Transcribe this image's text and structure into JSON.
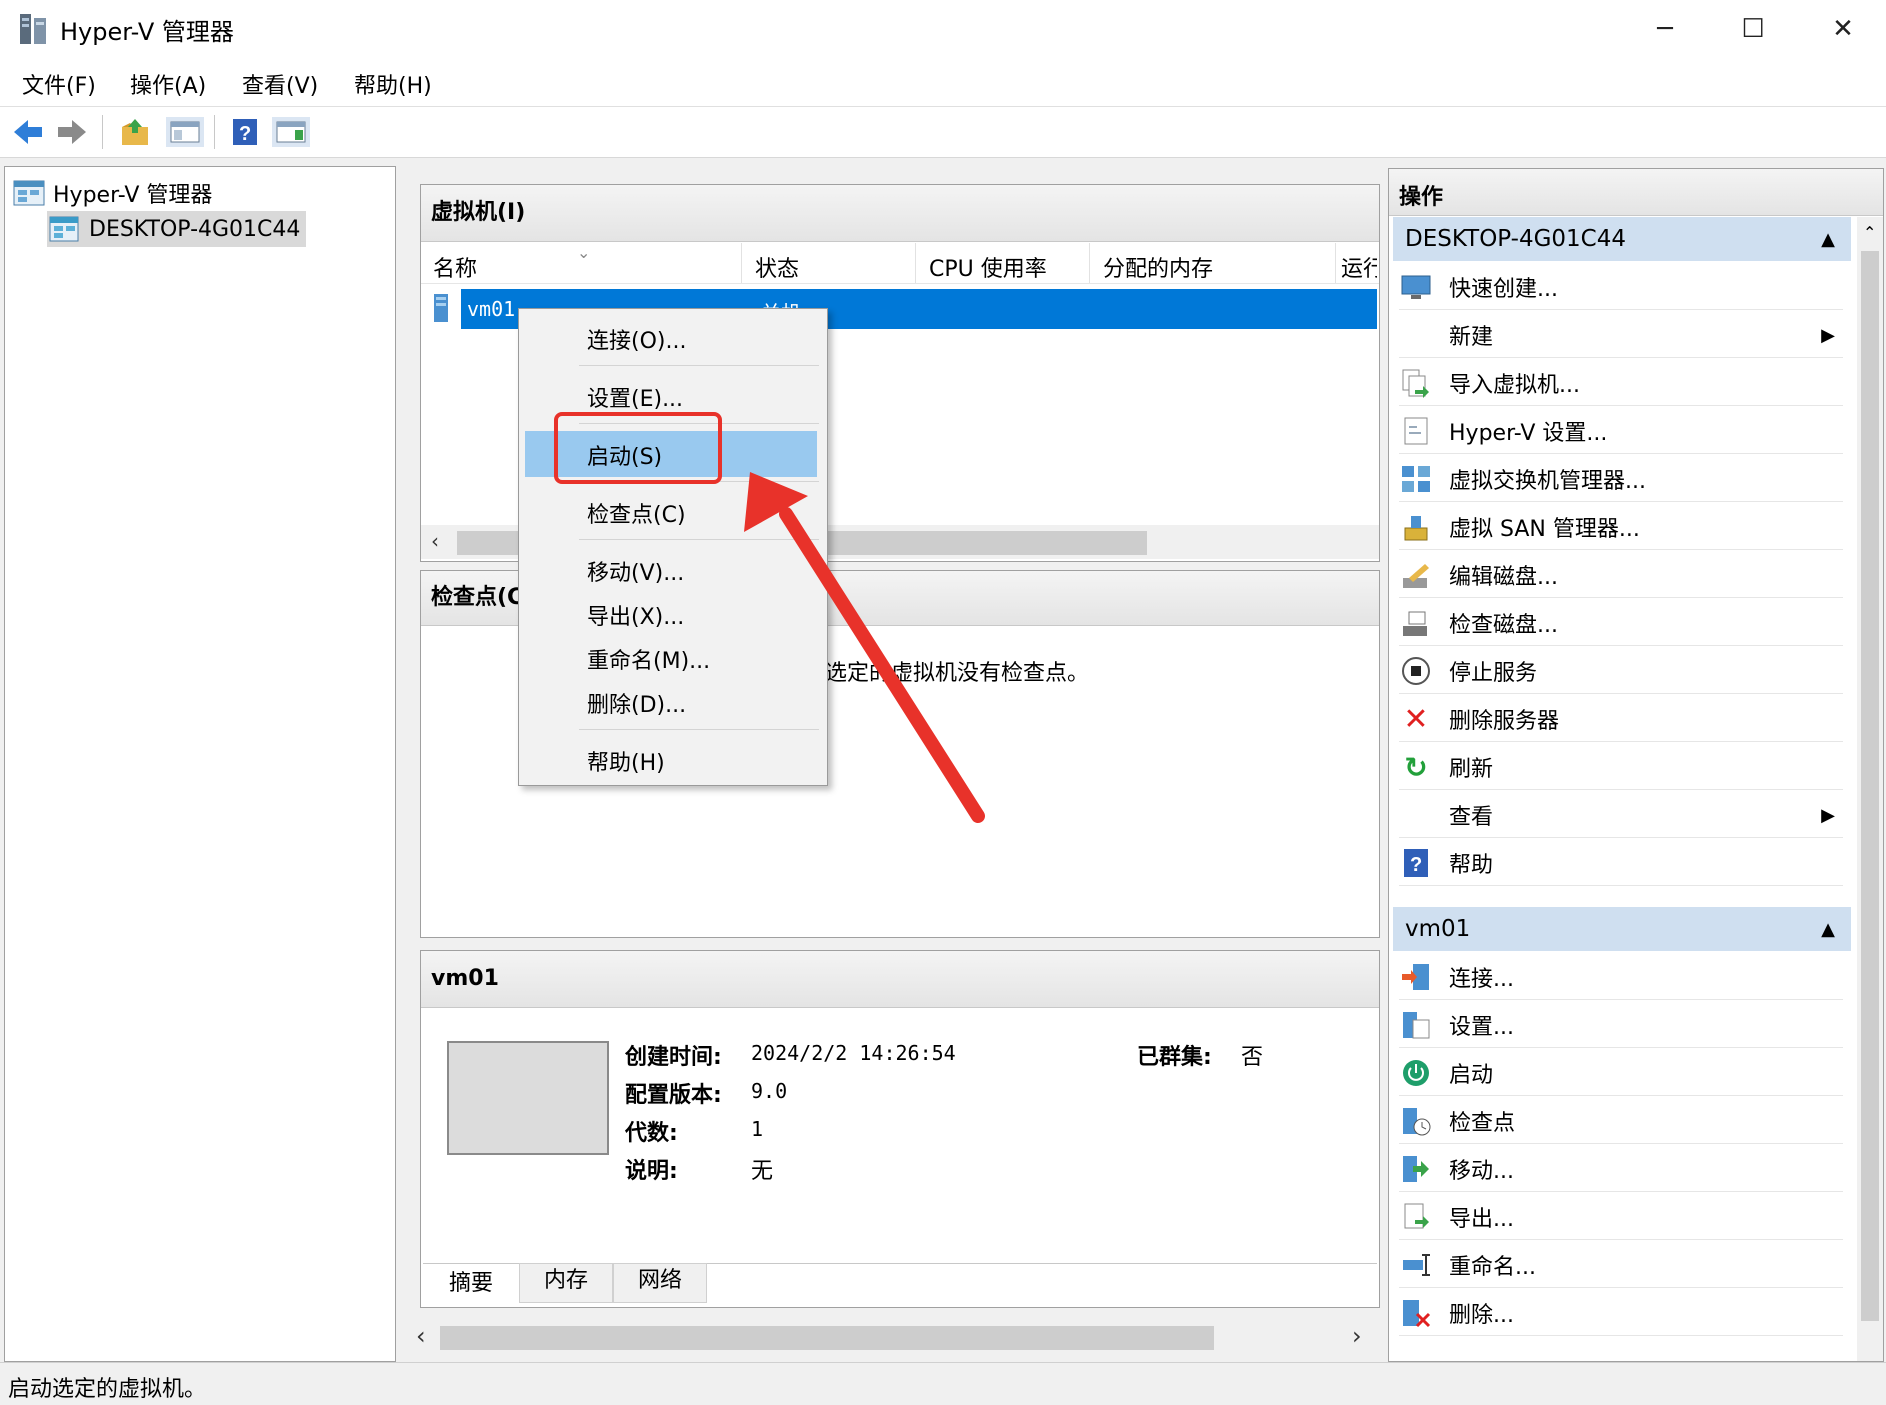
{
  "window": {
    "title": "Hyper-V 管理器"
  },
  "menu": [
    "文件(F)",
    "操作(A)",
    "查看(V)",
    "帮助(H)"
  ],
  "tree": {
    "root": "Hyper-V 管理器",
    "host": "DESKTOP-4G01C44"
  },
  "vms": {
    "title": "虚拟机(I)",
    "columns": [
      "名称",
      "状态",
      "CPU 使用率",
      "分配的内存",
      "运行"
    ],
    "rows": [
      {
        "name": "vm01",
        "state": "关机"
      }
    ]
  },
  "checkpoints": {
    "title": "检查点(C)",
    "empty": "选定的虚拟机没有检查点。"
  },
  "details": {
    "title": "vm01",
    "created_label": "创建时间:",
    "created_value": "2024/2/2 14:26:54",
    "version_label": "配置版本:",
    "version_value": "9.0",
    "generation_label": "代数:",
    "generation_value": "1",
    "notes_label": "说明:",
    "notes_value": "无",
    "cluster_label": "已群集:",
    "cluster_value": "否",
    "tabs": [
      "摘要",
      "内存",
      "网络"
    ]
  },
  "context_menu": [
    "连接(O)...",
    "设置(E)...",
    "启动(S)",
    "检查点(C)",
    "移动(V)...",
    "导出(X)...",
    "重命名(M)...",
    "删除(D)...",
    "帮助(H)"
  ],
  "actions": {
    "title": "操作",
    "host_section": "DESKTOP-4G01C44",
    "host_items": [
      "快速创建...",
      "新建",
      "导入虚拟机...",
      "Hyper-V 设置...",
      "虚拟交换机管理器...",
      "虚拟 SAN 管理器...",
      "编辑磁盘...",
      "检查磁盘...",
      "停止服务",
      "删除服务器",
      "刷新",
      "查看",
      "帮助"
    ],
    "vm_section": "vm01",
    "vm_items": [
      "连接...",
      "设置...",
      "启动",
      "检查点",
      "移动...",
      "导出...",
      "重命名...",
      "删除..."
    ]
  },
  "status": "启动选定的虚拟机。",
  "colors": {
    "selection": "#0078d7",
    "highlight": "#99c9ef",
    "annotation": "#e8322a",
    "section": "#cfdff0"
  }
}
